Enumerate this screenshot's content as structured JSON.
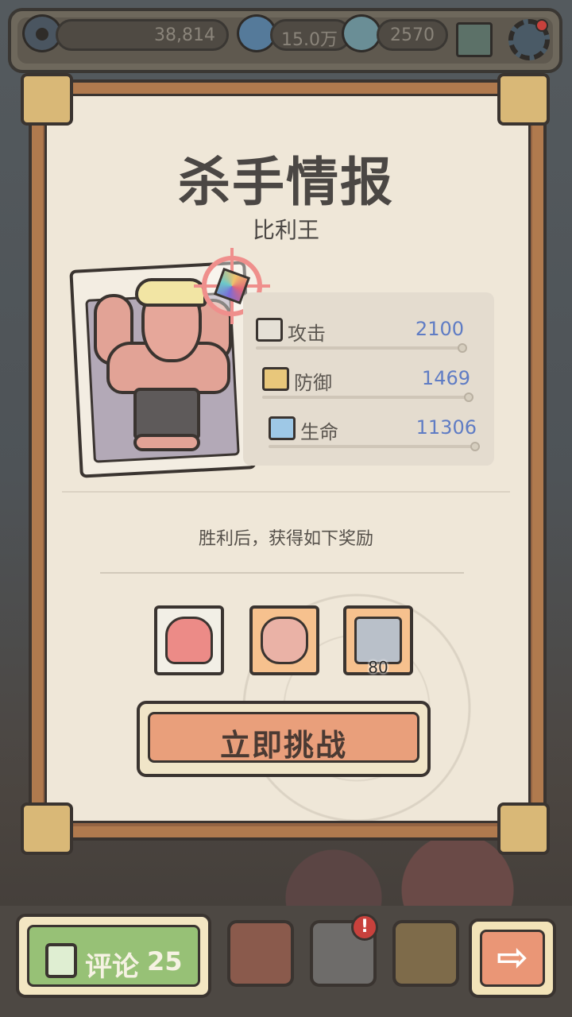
{
  "top_bar": {
    "views": "38,814",
    "comments": "15.0万",
    "messages": "2570"
  },
  "dossier": {
    "title": "杀手情报",
    "target_name": "比利王",
    "stats": [
      {
        "icon": "attack-icon",
        "label": "攻击",
        "value": "2100"
      },
      {
        "icon": "defense-icon",
        "label": "防御",
        "value": "1469"
      },
      {
        "icon": "health-icon",
        "label": "生命",
        "value": "11306"
      }
    ],
    "reward_title": "胜利后，获得如下奖励",
    "rewards": [
      {
        "icon": "ghost-icon",
        "count": ""
      },
      {
        "icon": "muscle-arm-icon",
        "count": ""
      },
      {
        "icon": "machine-icon",
        "count": "80"
      }
    ],
    "challenge_label": "立即挑战"
  },
  "bottom_bar": {
    "comment_label": "评论",
    "comment_count": "25",
    "badge": "!",
    "next_arrow": "⇨"
  },
  "colors": {
    "stat_value": "#5f7cc4",
    "challenge": "#e99f7b",
    "comment": "#97c176",
    "badge": "#c8413c"
  }
}
